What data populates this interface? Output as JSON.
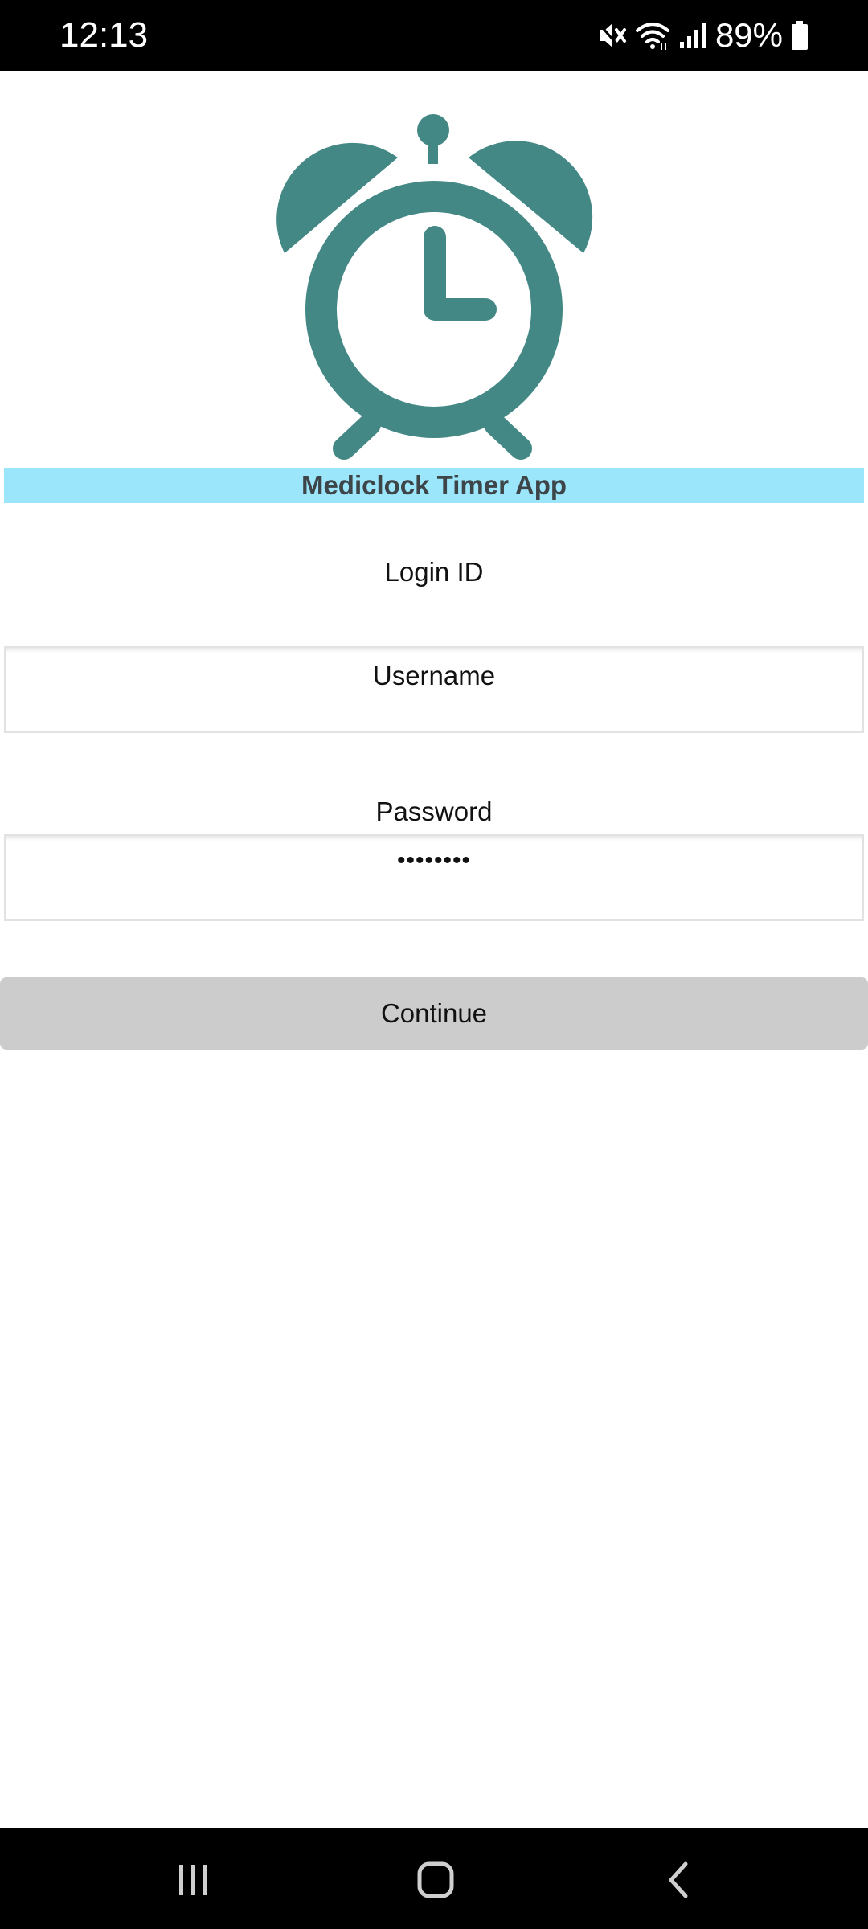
{
  "status_bar": {
    "time": "12:13",
    "battery_percent": "89%",
    "icons": [
      "mute-icon",
      "wifi-icon",
      "signal-icon",
      "battery-icon"
    ]
  },
  "app": {
    "title": "Mediclock Timer App",
    "logo_icon": "alarm-clock-icon",
    "logo_color": "#438885",
    "banner_color": "#9be6fb"
  },
  "form": {
    "login_id_label": "Login ID",
    "username_value": "Username",
    "password_label": "Password",
    "password_value": "••••••••",
    "continue_label": "Continue"
  },
  "nav_bar": {
    "icons": [
      "recent-apps-icon",
      "home-icon",
      "back-icon"
    ]
  }
}
